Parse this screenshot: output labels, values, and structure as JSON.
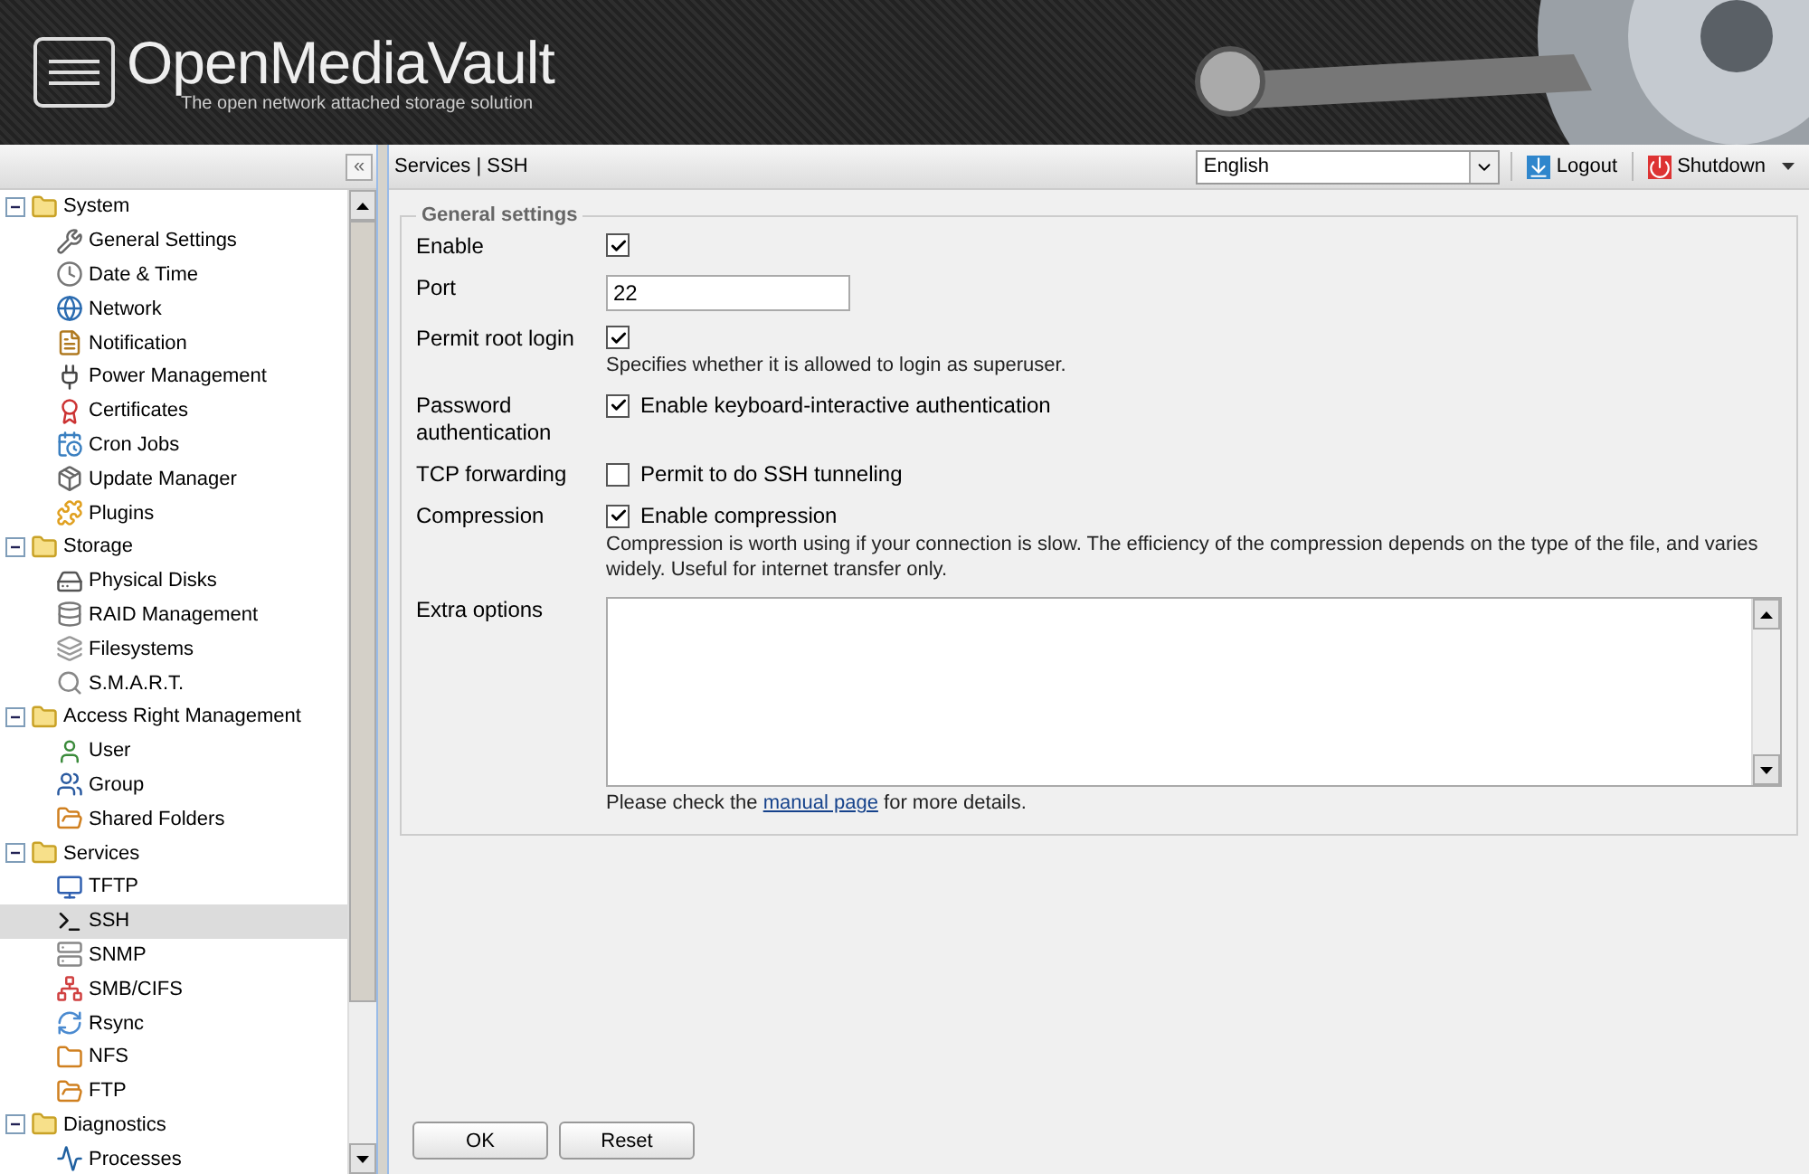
{
  "header": {
    "title": "OpenMediaVault",
    "subtitle": "The open network attached storage solution"
  },
  "sidebar": {
    "collapse": "«",
    "tree": [
      {
        "label": "System",
        "expanded": true,
        "children": [
          {
            "label": "General Settings",
            "selected": false
          },
          {
            "label": "Date & Time",
            "selected": false
          },
          {
            "label": "Network",
            "selected": false
          },
          {
            "label": "Notification",
            "selected": false
          },
          {
            "label": "Power Management",
            "selected": false
          },
          {
            "label": "Certificates",
            "selected": false
          },
          {
            "label": "Cron Jobs",
            "selected": false
          },
          {
            "label": "Update Manager",
            "selected": false
          },
          {
            "label": "Plugins",
            "selected": false
          }
        ]
      },
      {
        "label": "Storage",
        "expanded": true,
        "children": [
          {
            "label": "Physical Disks",
            "selected": false
          },
          {
            "label": "RAID Management",
            "selected": false
          },
          {
            "label": "Filesystems",
            "selected": false
          },
          {
            "label": "S.M.A.R.T.",
            "selected": false
          }
        ]
      },
      {
        "label": "Access Right Management",
        "expanded": true,
        "children": [
          {
            "label": "User",
            "selected": false
          },
          {
            "label": "Group",
            "selected": false
          },
          {
            "label": "Shared Folders",
            "selected": false
          }
        ]
      },
      {
        "label": "Services",
        "expanded": true,
        "children": [
          {
            "label": "TFTP",
            "selected": false
          },
          {
            "label": "SSH",
            "selected": true
          },
          {
            "label": "SNMP",
            "selected": false
          },
          {
            "label": "SMB/CIFS",
            "selected": false
          },
          {
            "label": "Rsync",
            "selected": false
          },
          {
            "label": "NFS",
            "selected": false
          },
          {
            "label": "FTP",
            "selected": false
          }
        ]
      },
      {
        "label": "Diagnostics",
        "expanded": true,
        "children": [
          {
            "label": "Processes",
            "selected": false
          }
        ]
      }
    ]
  },
  "toolbar": {
    "breadcrumb": "Services | SSH",
    "language": "English",
    "logout": "Logout",
    "shutdown": "Shutdown"
  },
  "form": {
    "legend": "General settings",
    "fields": [
      {
        "kind": "checkbox",
        "label": "Enable",
        "checked": true
      },
      {
        "kind": "text",
        "label": "Port",
        "value": "22"
      },
      {
        "kind": "checkbox",
        "label": "Permit root login",
        "checked": true,
        "hint": "Specifies whether it is allowed to login as superuser."
      },
      {
        "kind": "checkbox",
        "label": "Password authentication",
        "checked": true,
        "text": "Enable keyboard-interactive authentication"
      },
      {
        "kind": "checkbox",
        "label": "TCP forwarding",
        "checked": false,
        "text": "Permit to do SSH tunneling"
      },
      {
        "kind": "checkbox",
        "label": "Compression",
        "checked": true,
        "text": "Enable compression",
        "hint": "Compression is worth using if your connection is slow. The efficiency of the compression depends on the type of the file, and varies widely. Useful for internet transfer only."
      },
      {
        "kind": "textarea",
        "label": "Extra options",
        "hint_before": "Please check the",
        "link": "manual page",
        "hint_after": "for more details."
      }
    ]
  },
  "buttons": [
    "OK",
    "Reset"
  ]
}
